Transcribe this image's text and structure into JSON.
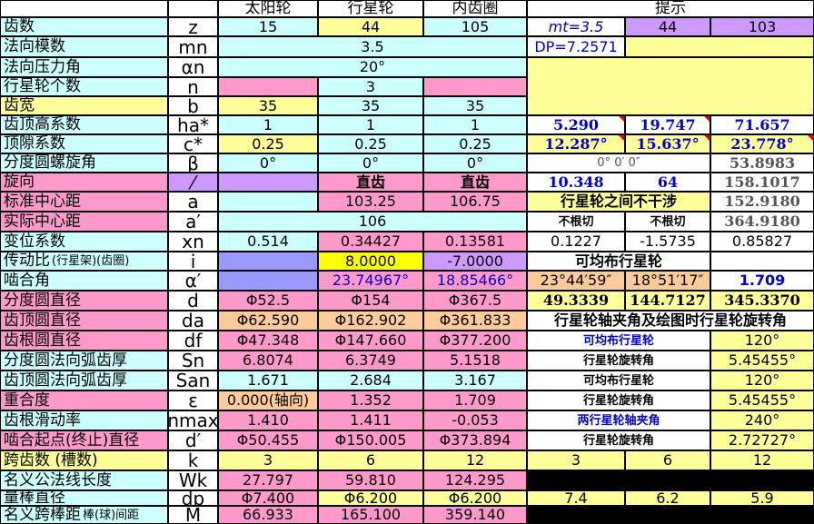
{
  "headers": {
    "sun": "太阳轮",
    "planet": "行星轮",
    "ring": "内齿圈",
    "hint": "提示"
  },
  "rows": [
    {
      "label": "齿数",
      "sym": "z"
    },
    {
      "label": "法向模数",
      "sym": "mn"
    },
    {
      "label": "法向压力角",
      "sym": "αn"
    },
    {
      "label": "行星轮个数",
      "sym": "n"
    },
    {
      "label": "齿宽",
      "sym": "b"
    },
    {
      "label": "齿顶高系数",
      "sym": "ha*"
    },
    {
      "label": "顶隙系数",
      "sym": "c*"
    },
    {
      "label": "分度圆螺旋角",
      "sym": "β"
    },
    {
      "label": "旋向",
      "sym": "⁄"
    },
    {
      "label": "标准中心距",
      "sym": "a"
    },
    {
      "label": "实际中心距",
      "sym": "a′"
    },
    {
      "label": "变位系数",
      "sym": "xn"
    },
    {
      "label": "传动比",
      "sub": "(行星架)(齿圈)",
      "sym": "i"
    },
    {
      "label": "啮合角",
      "sym": "α′"
    },
    {
      "label": "分度圆直径",
      "sym": "d"
    },
    {
      "label": "齿顶圆直径",
      "sym": "da"
    },
    {
      "label": "齿根圆直径",
      "sym": "df"
    },
    {
      "label": "分度圆法向弧齿厚",
      "sym": "Sn"
    },
    {
      "label": "齿顶圆法向弧齿厚",
      "sym": "San"
    },
    {
      "label": "重合度",
      "sym": "ε"
    },
    {
      "label": "齿根滑动率",
      "sym": "nmax"
    },
    {
      "label": "啮合起点(终止)直径",
      "sym": "d′"
    },
    {
      "label": "跨齿数 (槽数)",
      "sym": "k"
    },
    {
      "label": "名义公法线长度",
      "sym": "Wk"
    },
    {
      "label": "量棒直径",
      "sym": "dp"
    },
    {
      "label": "名义跨棒距",
      "sub": "棒(球)间距",
      "sym": "M"
    }
  ],
  "values": {
    "z": [
      "15",
      "44",
      "105"
    ],
    "mn": "3.5",
    "an": "20°",
    "n": "3",
    "b": [
      "35",
      "35",
      "35"
    ],
    "ha": [
      "1",
      "1",
      "1"
    ],
    "c": [
      "0.25",
      "0.25",
      "0.25"
    ],
    "beta": [
      "0°",
      "0°",
      "0°"
    ],
    "dir": [
      "直齿",
      "直齿"
    ],
    "a": [
      "103.25",
      "106.75"
    ],
    "a2": "106",
    "xn": [
      "0.514",
      "0.34427",
      "0.13581"
    ],
    "i": [
      "8.0000",
      "-7.0000"
    ],
    "alpha": [
      "23.74967°",
      "18.85466°"
    ],
    "d": [
      "Φ52.5",
      "Φ154",
      "Φ367.5"
    ],
    "da": [
      "Φ62.590",
      "Φ162.902",
      "Φ361.833"
    ],
    "df": [
      "Φ47.348",
      "Φ147.660",
      "Φ377.200"
    ],
    "sn": [
      "6.8074",
      "6.3749",
      "5.1518"
    ],
    "san": [
      "1.671",
      "2.684",
      "3.167"
    ],
    "eps": [
      "0.000(轴向)",
      "1.352",
      "1.709"
    ],
    "nmax": [
      "1.410",
      "1.411",
      "-0.053"
    ],
    "dd": [
      "Φ50.455",
      "Φ150.005",
      "Φ373.894"
    ],
    "k": [
      "3",
      "6",
      "12"
    ],
    "wk": [
      "27.797",
      "59.810",
      "124.295"
    ],
    "dp": [
      "Φ7.400",
      "Φ6.200",
      "Φ6.200"
    ],
    "m": [
      "66.933",
      "165.100",
      "359.140"
    ]
  },
  "hint": {
    "mt": "mt=3.5",
    "z2": "44",
    "z3": "103",
    "dp": "DP=7.2571",
    "r6": [
      "5.290",
      "19.747",
      "71.657"
    ],
    "r7": [
      "12.287°",
      "15.637°",
      "23.778°"
    ],
    "r8a": "0° 0′ 0″",
    "r8b": "53.8983",
    "r9": [
      "10.348",
      "64",
      "158.1017"
    ],
    "r10a": "行星轮之间不干涉",
    "r10b": "152.9180",
    "r11": [
      "不根切",
      "不根切",
      "364.9180"
    ],
    "r12": [
      "0.1227",
      "-1.5735",
      "0.85827"
    ],
    "r13": "可均布行星轮",
    "r14": [
      "23°44′59″",
      "18°51′17″",
      "1.709"
    ],
    "r15": [
      "49.3339",
      "144.7127",
      "345.3370"
    ],
    "r16": "行星轮轴夹角及绘图时行星轮旋转角",
    "r17": [
      "可均布行星轮",
      "120°"
    ],
    "r18": [
      "行星轮旋转角",
      "5.45455°"
    ],
    "r19": [
      "可均布行星轮",
      "120°"
    ],
    "r20": [
      "行星轮旋转角",
      "5.45455°"
    ],
    "r21": [
      "两行星轮轴夹角",
      "240°"
    ],
    "r22": [
      "行星轮旋转角",
      "2.72727°"
    ],
    "r23": [
      "3",
      "6",
      "12"
    ],
    "r25": [
      "7.4",
      "6.2",
      "5.9"
    ]
  },
  "colors": {
    "cyan": "#ccffff",
    "yellow": "#ffff99",
    "pink": "#ff99cc",
    "orange": "#ffcc99",
    "purple": "#cc99ff",
    "white": "#ffffff",
    "brightYellow": "#ffff00",
    "lavender": "#9999ff"
  }
}
